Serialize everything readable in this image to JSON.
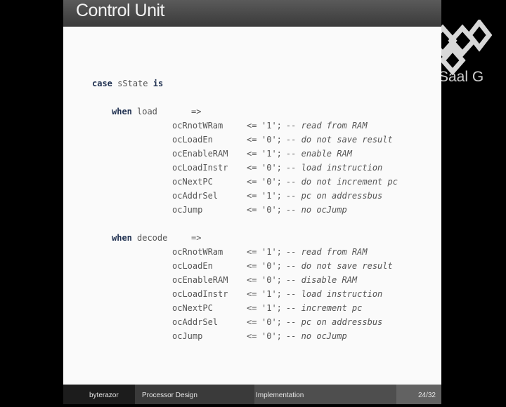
{
  "slide": {
    "title": "Control Unit",
    "logo_text": "Saal G"
  },
  "code": {
    "case_kw": "case",
    "case_var": "sState",
    "is_kw": "is",
    "when_kw": "when",
    "arrow": "=>",
    "assign": "<=",
    "blocks": [
      {
        "state": "load",
        "lines": [
          {
            "signal": "ocRnotWRam",
            "value": "'1';",
            "comment": "-- read from RAM"
          },
          {
            "signal": "ocLoadEn",
            "value": "'0';",
            "comment": "-- do not save result"
          },
          {
            "signal": "ocEnableRAM",
            "value": "'1';",
            "comment": "-- enable RAM"
          },
          {
            "signal": "ocLoadInstr",
            "value": "'0';",
            "comment": "-- load instruction"
          },
          {
            "signal": "ocNextPC",
            "value": "'0';",
            "comment": "-- do not increment pc"
          },
          {
            "signal": "ocAddrSel",
            "value": "'1';",
            "comment": "-- pc on addressbus"
          },
          {
            "signal": "ocJump",
            "value": "'0';",
            "comment": "-- no ocJump"
          }
        ]
      },
      {
        "state": "decode",
        "lines": [
          {
            "signal": "ocRnotWRam",
            "value": "'1';",
            "comment": "-- read from RAM"
          },
          {
            "signal": "ocLoadEn",
            "value": "'0';",
            "comment": "-- do not save result"
          },
          {
            "signal": "ocEnableRAM",
            "value": "'0';",
            "comment": "-- disable RAM"
          },
          {
            "signal": "ocLoadInstr",
            "value": "'1';",
            "comment": "-- load instruction"
          },
          {
            "signal": "ocNextPC",
            "value": "'1';",
            "comment": "-- increment pc"
          },
          {
            "signal": "ocAddrSel",
            "value": "'0';",
            "comment": "-- pc on addressbus"
          },
          {
            "signal": "ocJump",
            "value": "'0';",
            "comment": "-- no ocJump"
          }
        ]
      }
    ]
  },
  "footer": {
    "author": "byterazor",
    "talk": "Processor Design",
    "section": "Implementation",
    "page": "24/32"
  },
  "colors": {
    "footer_author_bg": "#1c1c1c",
    "footer_talk_bg": "#3a3a3a",
    "footer_section_bg": "#4e4e4e",
    "footer_page_bg": "#626262"
  }
}
